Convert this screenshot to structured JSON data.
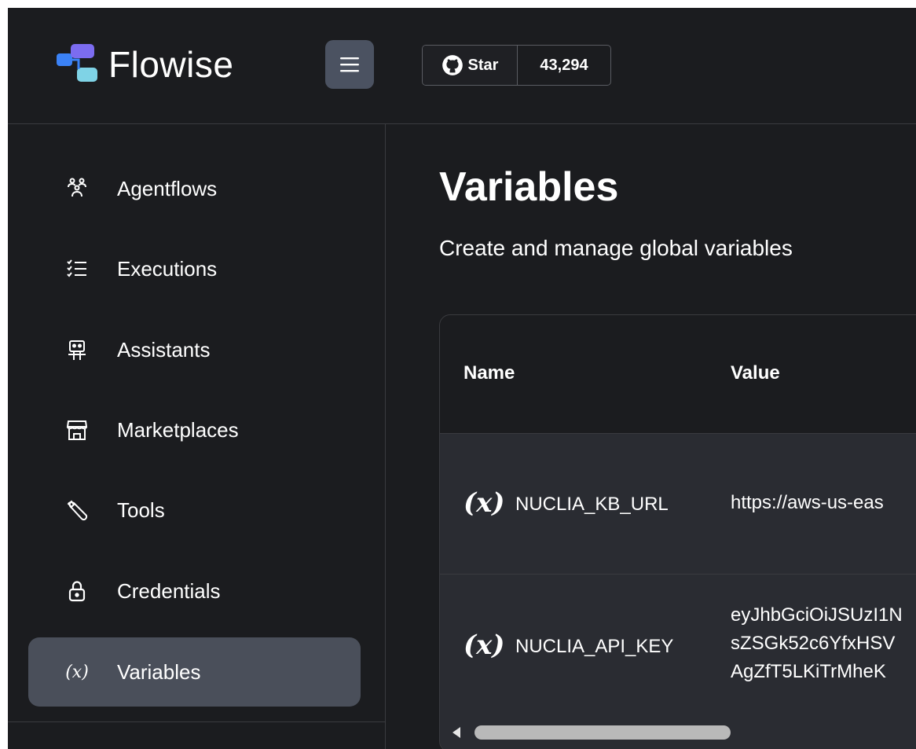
{
  "header": {
    "brand": "Flowise",
    "github": {
      "star_label": "Star",
      "star_count": "43,294"
    }
  },
  "sidebar": {
    "items": [
      {
        "label": "Agentflows",
        "icon": "agentflows-icon"
      },
      {
        "label": "Executions",
        "icon": "executions-icon"
      },
      {
        "label": "Assistants",
        "icon": "robot-icon"
      },
      {
        "label": "Marketplaces",
        "icon": "store-icon"
      },
      {
        "label": "Tools",
        "icon": "wrench-icon"
      },
      {
        "label": "Credentials",
        "icon": "lock-icon"
      },
      {
        "label": "Variables",
        "icon": "variable-icon",
        "active": true
      }
    ]
  },
  "main": {
    "title": "Variables",
    "subtitle": "Create and manage global variables",
    "table": {
      "columns": [
        "Name",
        "Value"
      ],
      "rows": [
        {
          "icon": "(x)",
          "name": "NUCLIA_KB_URL",
          "value_lines": [
            "https://aws-us-eas"
          ]
        },
        {
          "icon": "(x)",
          "name": "NUCLIA_API_KEY",
          "value_lines": [
            "eyJhbGciOiJSUzI1N",
            "sZSGk52c6YfxHSV",
            "AgZfT5LKiTrMheK"
          ]
        }
      ]
    }
  },
  "colors": {
    "background": "#1b1c1f",
    "active_item": "#4a4f5a",
    "menu_button": "#4b5261",
    "logo_blue": "#3b82f6",
    "logo_purple": "#7c6cf0",
    "logo_teal": "#7fd3e6"
  }
}
